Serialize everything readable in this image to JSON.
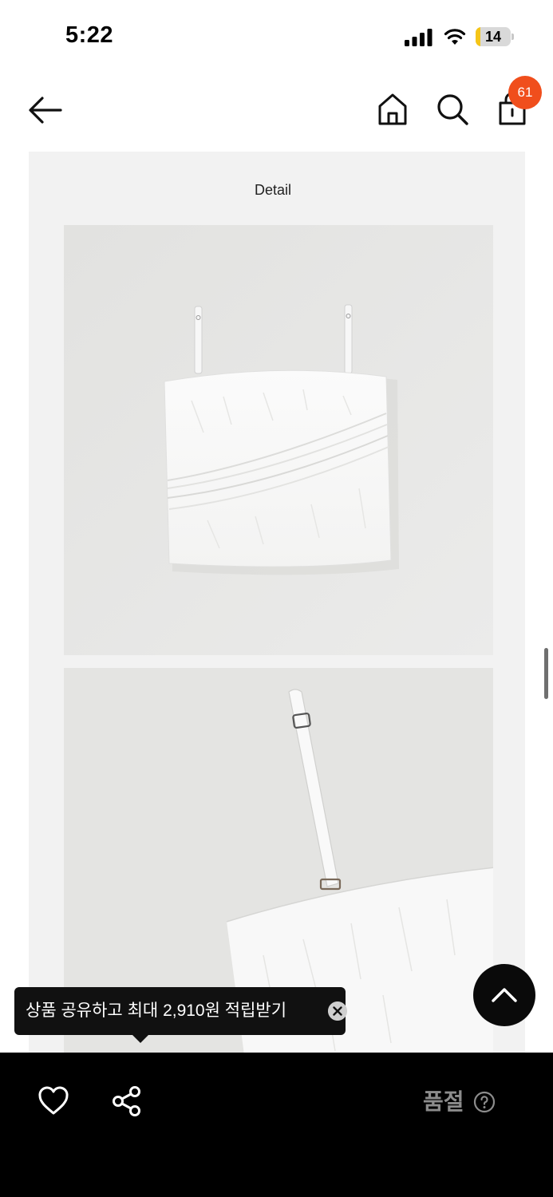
{
  "status_bar": {
    "time": "5:22",
    "battery_level": "14",
    "battery_fraction": 0.14,
    "icons": [
      "signal-icon",
      "wifi-icon",
      "battery-icon"
    ]
  },
  "header": {
    "icons": [
      "back-arrow-icon",
      "home-icon",
      "search-icon",
      "shopping-bag-icon"
    ],
    "cart_count": "61",
    "badge_color": "#f04e1c"
  },
  "content": {
    "section_title": "Detail",
    "photos": [
      "white-camisole-top-photo",
      "shoulder-strap-detail-photo"
    ],
    "background_color": "#f2f2f2"
  },
  "tooltip": {
    "text": "상품 공유하고 최대 2,910원 적립받기",
    "close_icon": "close-circle-icon"
  },
  "floating": {
    "scroll_top_icon": "chevron-up-icon"
  },
  "bottom_bar": {
    "status_text": "품절",
    "icons": [
      "heart-icon",
      "share-icon",
      "question-circle-icon"
    ]
  }
}
